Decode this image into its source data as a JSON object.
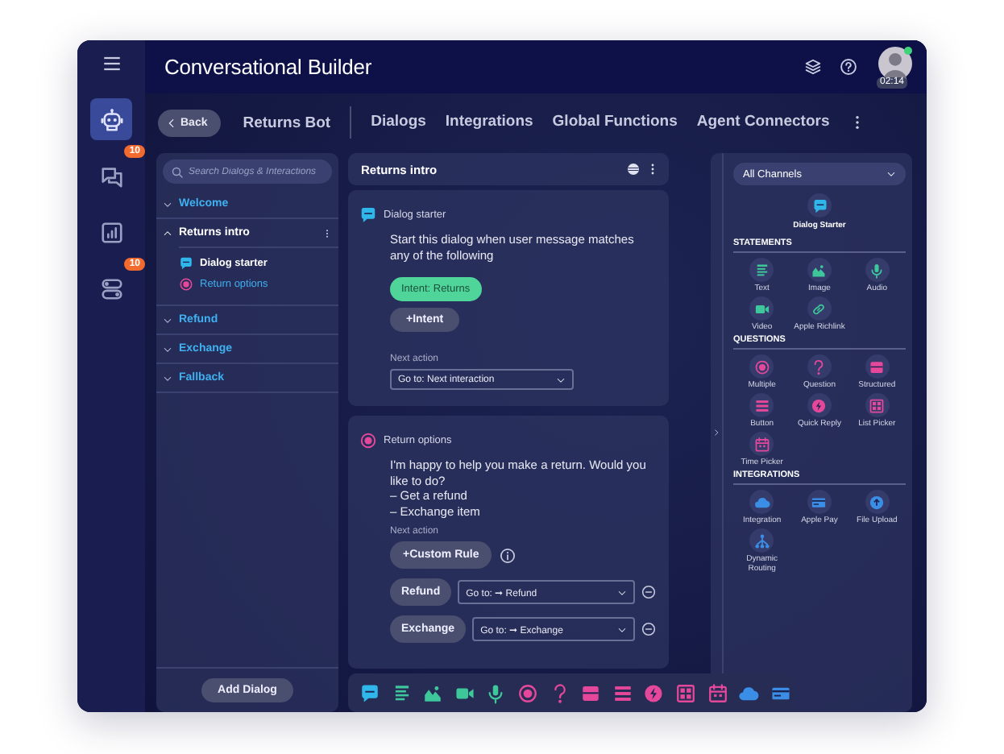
{
  "app": {
    "title": "Conversational Builder",
    "avatar_time": "02:14"
  },
  "rail": [
    {
      "kind": "robot",
      "selected": true
    },
    {
      "kind": "chat",
      "selected": false,
      "badge": "10"
    },
    {
      "kind": "chart",
      "selected": false
    },
    {
      "kind": "toggles",
      "selected": false,
      "badge": "10"
    }
  ],
  "nav": {
    "back": "Back",
    "bot": "Returns Bot",
    "tabs": [
      {
        "label": "Dialogs",
        "selected": false
      },
      {
        "label": "Integrations",
        "selected": false
      },
      {
        "label": "Global Functions",
        "selected": false
      },
      {
        "label": "Agent Connectors",
        "selected": false
      }
    ]
  },
  "dialogs": {
    "placeholder": "Search Dialogs & Interactions",
    "add": "Add Dialog",
    "items": [
      {
        "label": "Welcome",
        "expanded": false
      },
      {
        "label": "Returns intro",
        "expanded": true,
        "children": [
          {
            "label": "Dialog starter",
            "kind": "starter",
            "selected": true
          },
          {
            "label": "Return options",
            "kind": "question",
            "selected": false
          }
        ]
      },
      {
        "label": "Refund",
        "expanded": false
      },
      {
        "label": "Exchange",
        "expanded": false
      },
      {
        "label": "Fallback",
        "expanded": false
      }
    ]
  },
  "canvas": {
    "title": "Returns intro",
    "cards": [
      {
        "kind": "starter",
        "title": "Dialog starter",
        "text": "Start this dialog when user message matches any of the following",
        "intents": [
          "Intent: Returns"
        ],
        "add": "+Intent",
        "next_label": "Next action",
        "next": "Go to: Next interaction"
      },
      {
        "kind": "question",
        "title": "Return options",
        "text": "I'm happy to help you make a return. Would you like to do?\n– Get a refund\n– Exchange item",
        "next_label": "Next action",
        "add": "+Custom Rule",
        "rules": [
          {
            "label": "Refund",
            "target": "Go to: ➞ Refund"
          },
          {
            "label": "Exchange",
            "target": "Go to: ➞ Exchange"
          }
        ]
      }
    ]
  },
  "toolbar": [
    {
      "kind": "speech"
    },
    {
      "kind": "text"
    },
    {
      "kind": "image"
    },
    {
      "kind": "video"
    },
    {
      "kind": "mic"
    },
    {
      "kind": "radio"
    },
    {
      "kind": "question"
    },
    {
      "kind": "form"
    },
    {
      "kind": "list"
    },
    {
      "kind": "bolt"
    },
    {
      "kind": "grid"
    },
    {
      "kind": "calendar"
    },
    {
      "kind": "cloud"
    },
    {
      "kind": "card"
    }
  ],
  "palette": {
    "channel": "All Channels",
    "starter": "Dialog Starter",
    "sections": [
      {
        "title": "STATEMENTS",
        "kind": "statement",
        "items": [
          {
            "label": "Text",
            "kind": "text"
          },
          {
            "label": "Image",
            "kind": "image"
          },
          {
            "label": "Audio",
            "kind": "mic"
          },
          {
            "label": "Video",
            "kind": "video"
          },
          {
            "label": "Apple Richlink",
            "kind": "link"
          }
        ]
      },
      {
        "title": "QUESTIONS",
        "kind": "question",
        "items": [
          {
            "label": "Multiple",
            "kind": "radio"
          },
          {
            "label": "Question",
            "kind": "question"
          },
          {
            "label": "Structured",
            "kind": "form"
          },
          {
            "label": "Button",
            "kind": "list"
          },
          {
            "label": "Quick Reply",
            "kind": "bolt"
          },
          {
            "label": "List Picker",
            "kind": "grid"
          },
          {
            "label": "Time Picker",
            "kind": "calendar"
          }
        ]
      },
      {
        "title": "INTEGRATIONS",
        "kind": "integration",
        "items": [
          {
            "label": "Integration",
            "kind": "cloud"
          },
          {
            "label": "Apple Pay",
            "kind": "card"
          },
          {
            "label": "File Upload",
            "kind": "upload"
          },
          {
            "label": "Dynamic\nRouting",
            "kind": "network"
          }
        ]
      }
    ]
  }
}
